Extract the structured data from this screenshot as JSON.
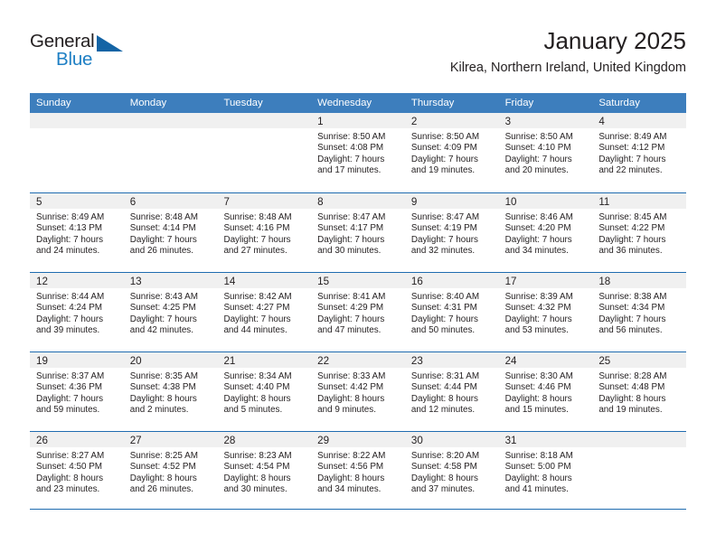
{
  "brand": {
    "name_part1": "General",
    "name_part2": "Blue",
    "logo_icon": "triangle-flag-icon",
    "accent_color": "#1e7fc4"
  },
  "header": {
    "title": "January 2025",
    "subtitle": "Kilrea, Northern Ireland, United Kingdom"
  },
  "calendar": {
    "header_bg": "#3d7ebd",
    "week_rule_color": "#1f6cb0",
    "daynum_strip_bg": "#f0f0f0",
    "weekdays": [
      "Sunday",
      "Monday",
      "Tuesday",
      "Wednesday",
      "Thursday",
      "Friday",
      "Saturday"
    ],
    "weeks": [
      [
        {
          "day": "",
          "lines": []
        },
        {
          "day": "",
          "lines": []
        },
        {
          "day": "",
          "lines": []
        },
        {
          "day": "1",
          "lines": [
            "Sunrise: 8:50 AM",
            "Sunset: 4:08 PM",
            "Daylight: 7 hours",
            "and 17 minutes."
          ]
        },
        {
          "day": "2",
          "lines": [
            "Sunrise: 8:50 AM",
            "Sunset: 4:09 PM",
            "Daylight: 7 hours",
            "and 19 minutes."
          ]
        },
        {
          "day": "3",
          "lines": [
            "Sunrise: 8:50 AM",
            "Sunset: 4:10 PM",
            "Daylight: 7 hours",
            "and 20 minutes."
          ]
        },
        {
          "day": "4",
          "lines": [
            "Sunrise: 8:49 AM",
            "Sunset: 4:12 PM",
            "Daylight: 7 hours",
            "and 22 minutes."
          ]
        }
      ],
      [
        {
          "day": "5",
          "lines": [
            "Sunrise: 8:49 AM",
            "Sunset: 4:13 PM",
            "Daylight: 7 hours",
            "and 24 minutes."
          ]
        },
        {
          "day": "6",
          "lines": [
            "Sunrise: 8:48 AM",
            "Sunset: 4:14 PM",
            "Daylight: 7 hours",
            "and 26 minutes."
          ]
        },
        {
          "day": "7",
          "lines": [
            "Sunrise: 8:48 AM",
            "Sunset: 4:16 PM",
            "Daylight: 7 hours",
            "and 27 minutes."
          ]
        },
        {
          "day": "8",
          "lines": [
            "Sunrise: 8:47 AM",
            "Sunset: 4:17 PM",
            "Daylight: 7 hours",
            "and 30 minutes."
          ]
        },
        {
          "day": "9",
          "lines": [
            "Sunrise: 8:47 AM",
            "Sunset: 4:19 PM",
            "Daylight: 7 hours",
            "and 32 minutes."
          ]
        },
        {
          "day": "10",
          "lines": [
            "Sunrise: 8:46 AM",
            "Sunset: 4:20 PM",
            "Daylight: 7 hours",
            "and 34 minutes."
          ]
        },
        {
          "day": "11",
          "lines": [
            "Sunrise: 8:45 AM",
            "Sunset: 4:22 PM",
            "Daylight: 7 hours",
            "and 36 minutes."
          ]
        }
      ],
      [
        {
          "day": "12",
          "lines": [
            "Sunrise: 8:44 AM",
            "Sunset: 4:24 PM",
            "Daylight: 7 hours",
            "and 39 minutes."
          ]
        },
        {
          "day": "13",
          "lines": [
            "Sunrise: 8:43 AM",
            "Sunset: 4:25 PM",
            "Daylight: 7 hours",
            "and 42 minutes."
          ]
        },
        {
          "day": "14",
          "lines": [
            "Sunrise: 8:42 AM",
            "Sunset: 4:27 PM",
            "Daylight: 7 hours",
            "and 44 minutes."
          ]
        },
        {
          "day": "15",
          "lines": [
            "Sunrise: 8:41 AM",
            "Sunset: 4:29 PM",
            "Daylight: 7 hours",
            "and 47 minutes."
          ]
        },
        {
          "day": "16",
          "lines": [
            "Sunrise: 8:40 AM",
            "Sunset: 4:31 PM",
            "Daylight: 7 hours",
            "and 50 minutes."
          ]
        },
        {
          "day": "17",
          "lines": [
            "Sunrise: 8:39 AM",
            "Sunset: 4:32 PM",
            "Daylight: 7 hours",
            "and 53 minutes."
          ]
        },
        {
          "day": "18",
          "lines": [
            "Sunrise: 8:38 AM",
            "Sunset: 4:34 PM",
            "Daylight: 7 hours",
            "and 56 minutes."
          ]
        }
      ],
      [
        {
          "day": "19",
          "lines": [
            "Sunrise: 8:37 AM",
            "Sunset: 4:36 PM",
            "Daylight: 7 hours",
            "and 59 minutes."
          ]
        },
        {
          "day": "20",
          "lines": [
            "Sunrise: 8:35 AM",
            "Sunset: 4:38 PM",
            "Daylight: 8 hours",
            "and 2 minutes."
          ]
        },
        {
          "day": "21",
          "lines": [
            "Sunrise: 8:34 AM",
            "Sunset: 4:40 PM",
            "Daylight: 8 hours",
            "and 5 minutes."
          ]
        },
        {
          "day": "22",
          "lines": [
            "Sunrise: 8:33 AM",
            "Sunset: 4:42 PM",
            "Daylight: 8 hours",
            "and 9 minutes."
          ]
        },
        {
          "day": "23",
          "lines": [
            "Sunrise: 8:31 AM",
            "Sunset: 4:44 PM",
            "Daylight: 8 hours",
            "and 12 minutes."
          ]
        },
        {
          "day": "24",
          "lines": [
            "Sunrise: 8:30 AM",
            "Sunset: 4:46 PM",
            "Daylight: 8 hours",
            "and 15 minutes."
          ]
        },
        {
          "day": "25",
          "lines": [
            "Sunrise: 8:28 AM",
            "Sunset: 4:48 PM",
            "Daylight: 8 hours",
            "and 19 minutes."
          ]
        }
      ],
      [
        {
          "day": "26",
          "lines": [
            "Sunrise: 8:27 AM",
            "Sunset: 4:50 PM",
            "Daylight: 8 hours",
            "and 23 minutes."
          ]
        },
        {
          "day": "27",
          "lines": [
            "Sunrise: 8:25 AM",
            "Sunset: 4:52 PM",
            "Daylight: 8 hours",
            "and 26 minutes."
          ]
        },
        {
          "day": "28",
          "lines": [
            "Sunrise: 8:23 AM",
            "Sunset: 4:54 PM",
            "Daylight: 8 hours",
            "and 30 minutes."
          ]
        },
        {
          "day": "29",
          "lines": [
            "Sunrise: 8:22 AM",
            "Sunset: 4:56 PM",
            "Daylight: 8 hours",
            "and 34 minutes."
          ]
        },
        {
          "day": "30",
          "lines": [
            "Sunrise: 8:20 AM",
            "Sunset: 4:58 PM",
            "Daylight: 8 hours",
            "and 37 minutes."
          ]
        },
        {
          "day": "31",
          "lines": [
            "Sunrise: 8:18 AM",
            "Sunset: 5:00 PM",
            "Daylight: 8 hours",
            "and 41 minutes."
          ]
        },
        {
          "day": "",
          "lines": []
        }
      ]
    ]
  }
}
